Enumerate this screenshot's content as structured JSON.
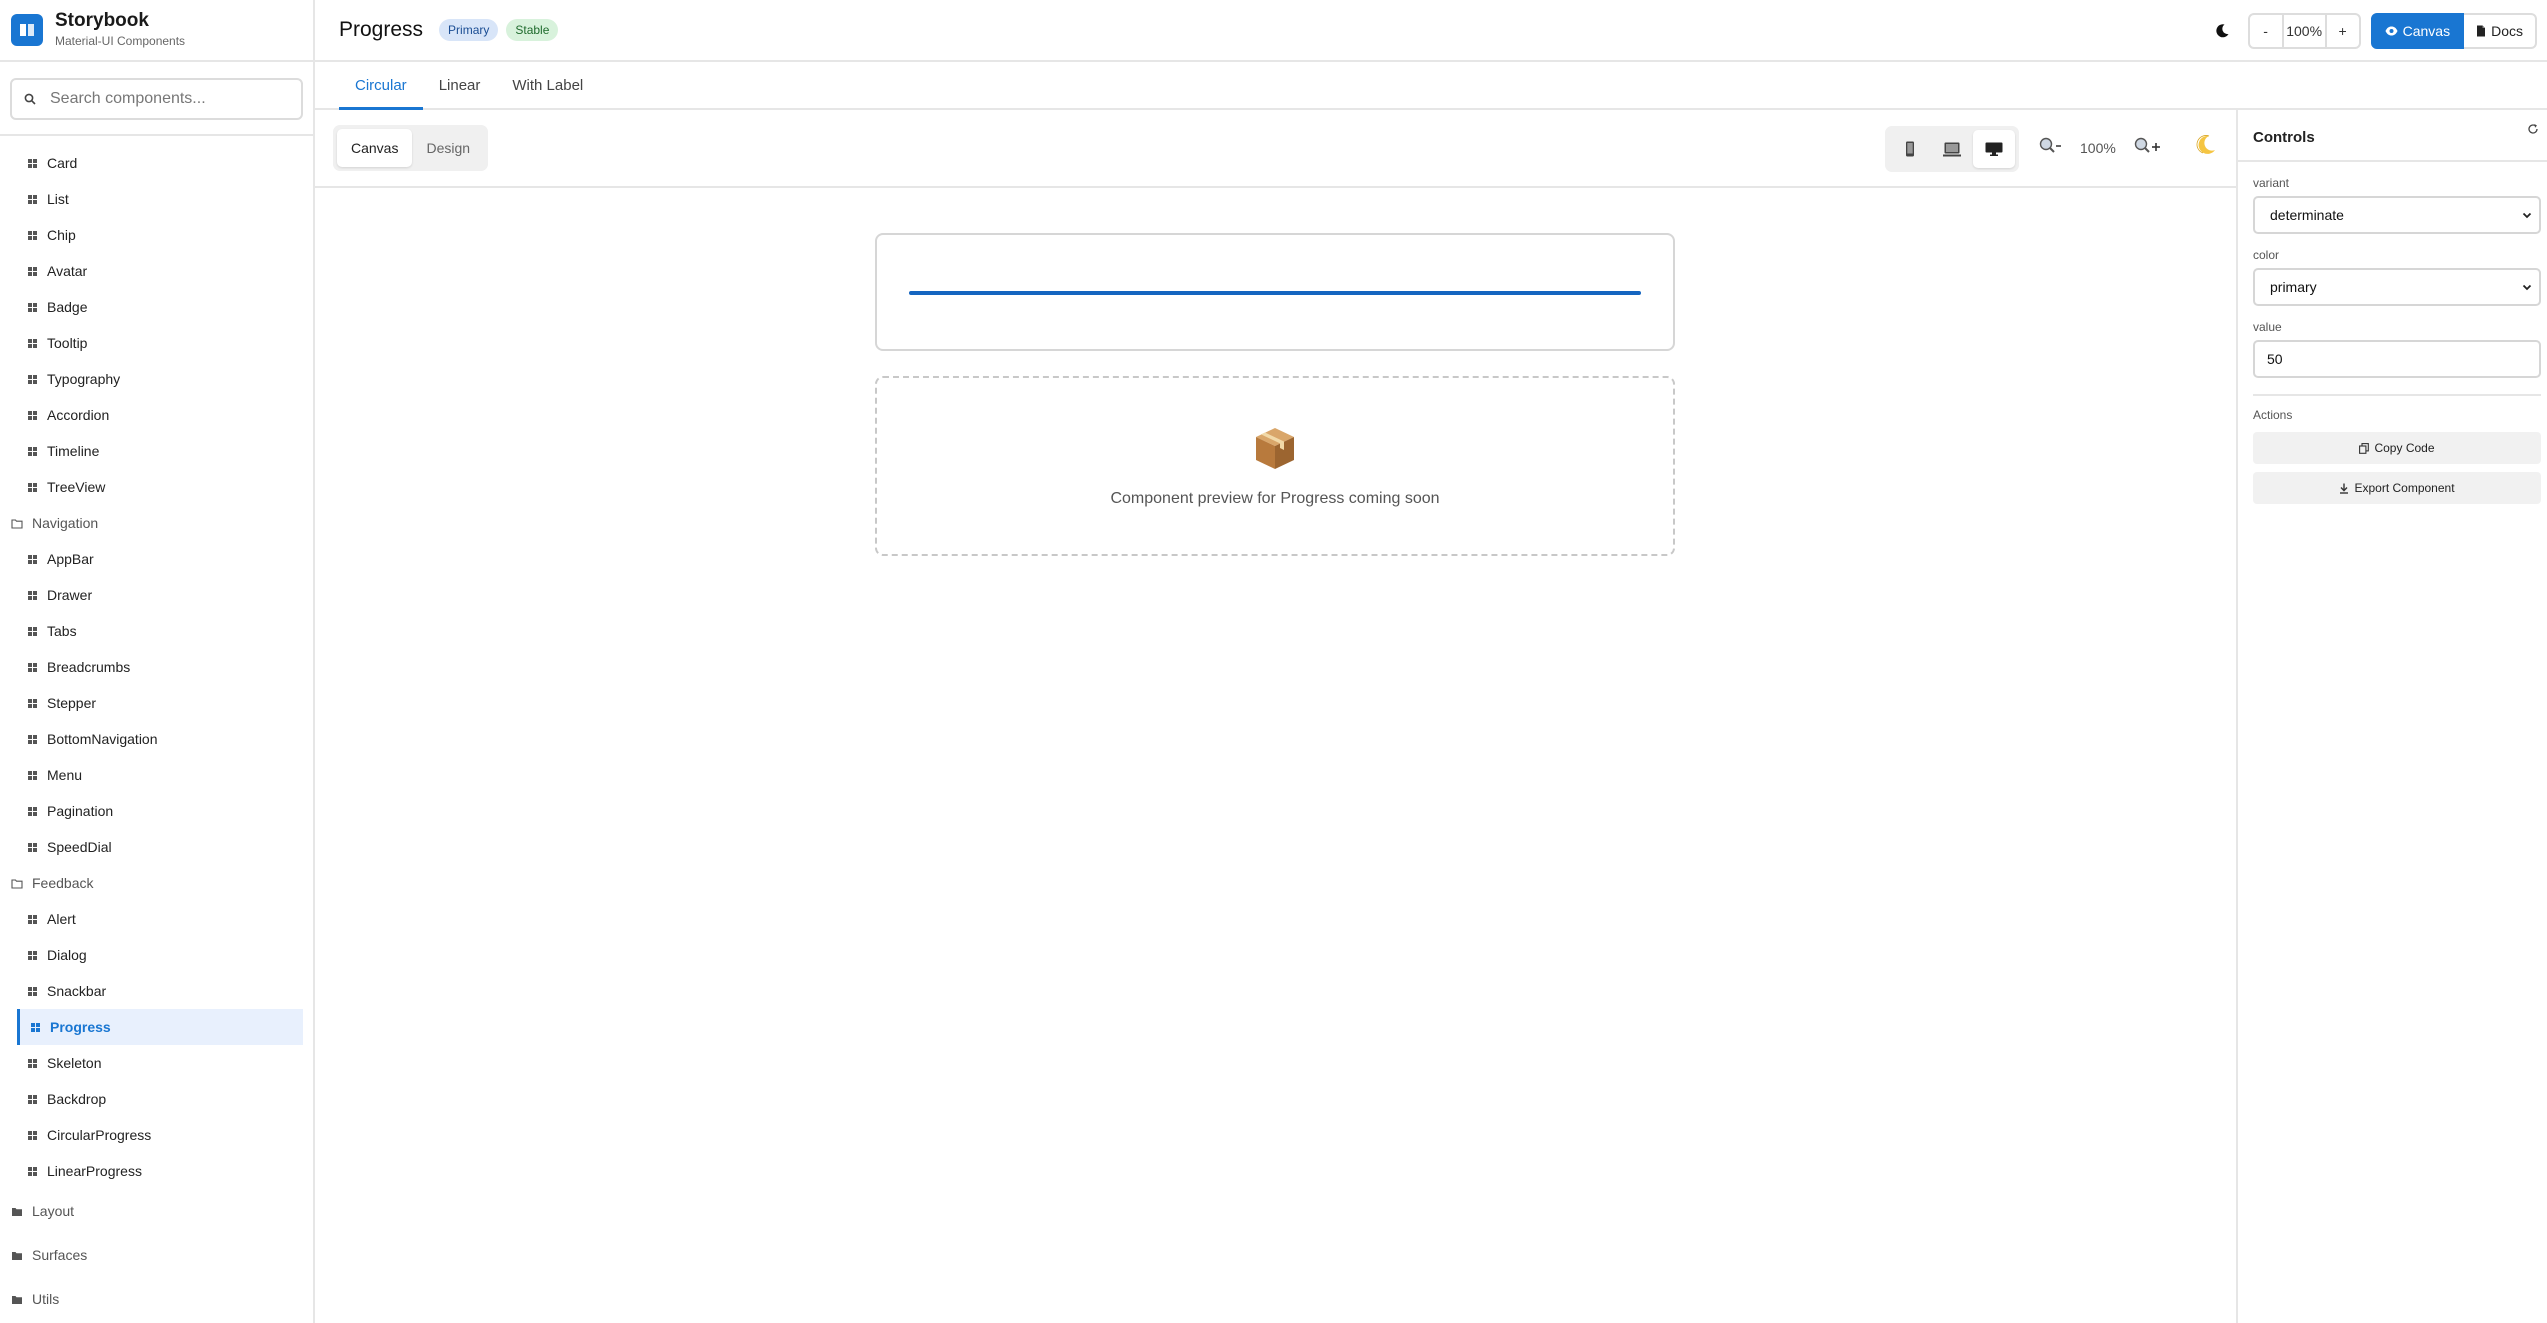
{
  "brand": {
    "title": "Storybook",
    "subtitle": "Material-UI Components"
  },
  "search": {
    "placeholder": "Search components..."
  },
  "sidebar": {
    "top_items": [
      "Card",
      "List",
      "Chip",
      "Avatar",
      "Badge",
      "Tooltip",
      "Typography",
      "Accordion",
      "Timeline",
      "TreeView"
    ],
    "navigation": {
      "label": "Navigation",
      "items": [
        "AppBar",
        "Drawer",
        "Tabs",
        "Breadcrumbs",
        "Stepper",
        "BottomNavigation",
        "Menu",
        "Pagination",
        "SpeedDial"
      ]
    },
    "feedback": {
      "label": "Feedback",
      "items": [
        "Alert",
        "Dialog",
        "Snackbar",
        "Progress",
        "Skeleton",
        "Backdrop",
        "CircularProgress",
        "LinearProgress"
      ],
      "active": "Progress"
    },
    "collapsed_groups": [
      "Layout",
      "Surfaces",
      "Utils"
    ]
  },
  "header": {
    "title": "Progress",
    "badges": {
      "primary": "Primary",
      "stable": "Stable"
    },
    "zoom": {
      "minus": "-",
      "value": "100%",
      "plus": "+"
    },
    "modes": {
      "canvas": "Canvas",
      "docs": "Docs"
    }
  },
  "tabs": [
    "Circular",
    "Linear",
    "With Label"
  ],
  "toolbar": {
    "view_canvas": "Canvas",
    "view_design": "Design",
    "zoom_value": "100%"
  },
  "canvas": {
    "progress_value": 100,
    "placeholder_text": "Component preview for Progress coming soon"
  },
  "controls": {
    "title": "Controls",
    "variant": {
      "label": "variant",
      "value": "determinate"
    },
    "color": {
      "label": "color",
      "value": "primary"
    },
    "value": {
      "label": "value",
      "value": "50"
    },
    "actions": {
      "label": "Actions",
      "copy": "Copy Code",
      "export": "Export Component"
    }
  },
  "colors": {
    "accent": "#1976d2",
    "progress": "#1565c0"
  }
}
